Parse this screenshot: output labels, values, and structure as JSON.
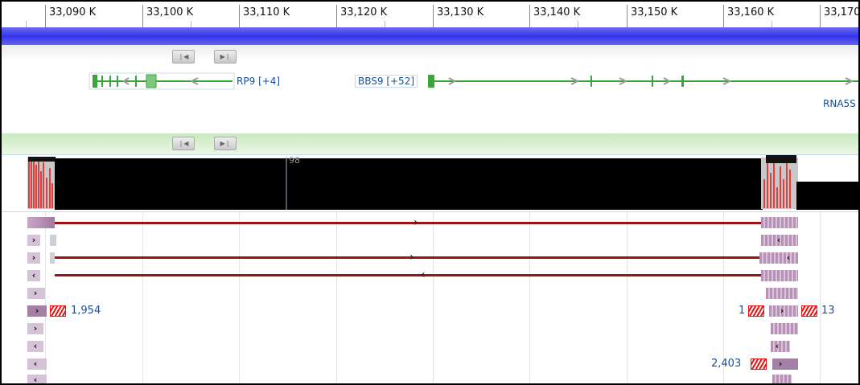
{
  "ruler": {
    "ticks": [
      "33,090 K",
      "33,100 K",
      "33,110 K",
      "33,120 K",
      "33,130 K",
      "33,140 K",
      "33,150 K",
      "33,160 K",
      "33,170"
    ]
  },
  "genes_track": {
    "nav_prev_label": "❘◀",
    "nav_next_label": "▶❘",
    "genes": [
      {
        "label": "RP9 [+4]"
      },
      {
        "label": "BBS9 [+52]"
      },
      {
        "label": "RNA5S"
      }
    ]
  },
  "coverage_track": {
    "max_label": "98"
  },
  "reads_track": {
    "counts": {
      "left_overflow": "1,954",
      "right_before": "1",
      "right_after": "13",
      "bottom_right": "2,403"
    }
  },
  "colors": {
    "accent_blue": "#3434e8",
    "gene_green": "#3aa63a",
    "junction_red": "#9c1313",
    "read_purple": "#a47fa6"
  }
}
